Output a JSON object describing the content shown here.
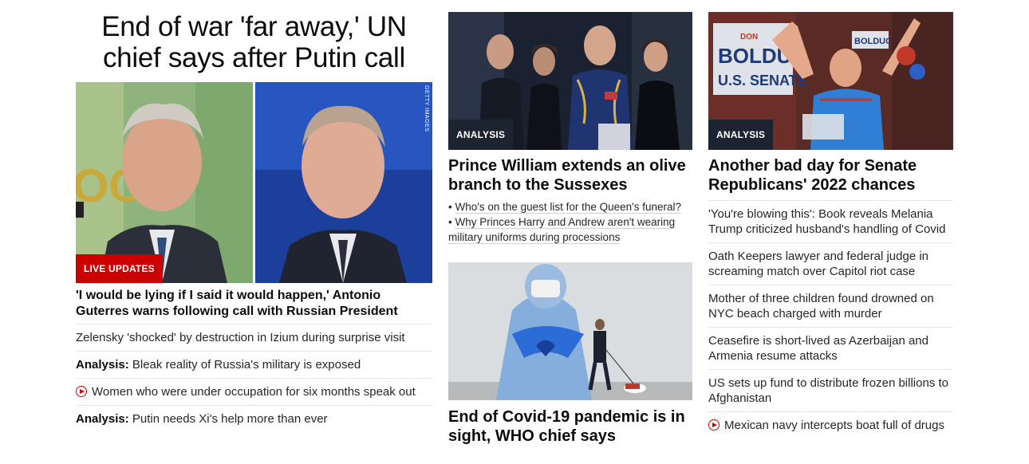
{
  "col1": {
    "headline": "End of war 'far away,' UN chief says after Putin call",
    "image_credit": "GETTY IMAGES",
    "badge": "LIVE UPDATES",
    "caption": "'I would be lying if I said it would happen,' Antonio Guterres warns following call with Russian President",
    "items": [
      {
        "prefix": "",
        "text": "Zelensky 'shocked' by destruction in Izium during surprise visit",
        "video": false
      },
      {
        "prefix": "Analysis:",
        "text": "Bleak reality of Russia's military is exposed",
        "video": false
      },
      {
        "prefix": "",
        "text": "Women who were under occupation for six months speak out",
        "video": true
      },
      {
        "prefix": "Analysis:",
        "text": "Putin needs Xi's help more than ever",
        "video": false
      }
    ]
  },
  "col2": {
    "card1": {
      "badge": "ANALYSIS",
      "title": "Prince William extends an olive branch to the Sussexes",
      "bullets": [
        "Who's on the guest list for the Queen's funeral?",
        "Why Princes Harry and Andrew aren't wearing military uniforms during processions"
      ]
    },
    "card2": {
      "title": "End of Covid-19 pandemic is in sight, WHO chief says"
    }
  },
  "col3": {
    "badge": "ANALYSIS",
    "sign_text": [
      "DON",
      "BOLDUC",
      "U.S. SENATE"
    ],
    "title": "Another bad day for Senate Republicans' 2022 chances",
    "items": [
      {
        "text": "'You're blowing this': Book reveals Melania Trump criticized husband's handling of Covid",
        "video": false
      },
      {
        "text": "Oath Keepers lawyer and federal judge in screaming match over Capitol riot case",
        "video": false
      },
      {
        "text": "Mother of three children found drowned on NYC beach charged with murder",
        "video": false
      },
      {
        "text": "Ceasefire is short-lived as Azerbaijan and Armenia resume attacks",
        "video": false
      },
      {
        "text": "US sets up fund to distribute frozen billions to Afghanistan",
        "video": false
      },
      {
        "text": "Mexican navy intercepts boat full of drugs",
        "video": true
      }
    ]
  }
}
